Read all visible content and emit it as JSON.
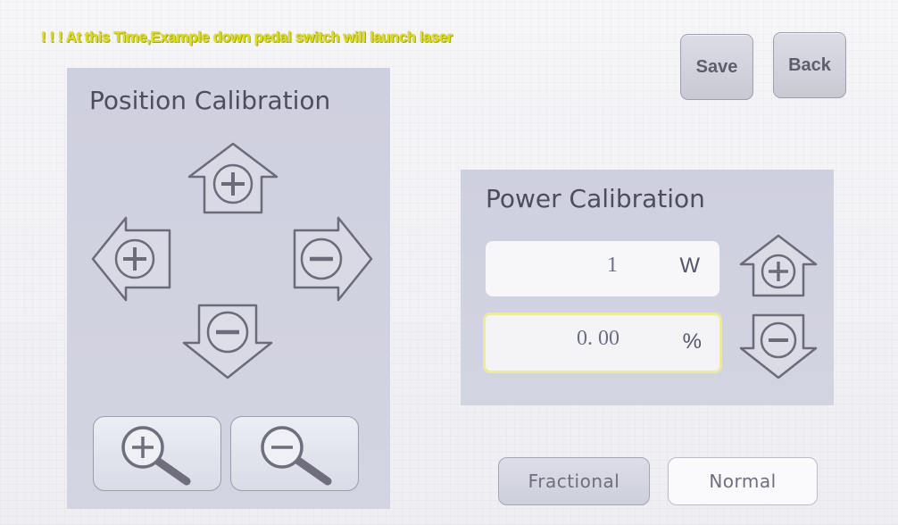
{
  "warning_text": "! ! ! At this Time,Example down pedal switch will launch laser",
  "header": {
    "save_label": "Save",
    "back_label": "Back"
  },
  "position_calibration": {
    "title": "Position Calibration",
    "controls": [
      "up-plus-arrow-icon",
      "left-plus-arrow-icon",
      "right-minus-arrow-icon",
      "down-minus-arrow-icon"
    ],
    "zoom": [
      "zoom-in-icon",
      "zoom-out-icon"
    ]
  },
  "power_calibration": {
    "title": "Power Calibration",
    "power_value": "1",
    "power_unit": "W",
    "percent_value": "0. 00",
    "percent_unit": "%"
  },
  "modes": {
    "fractional_label": "Fractional",
    "normal_label": "Normal"
  },
  "colors": {
    "panel": "#d1d2e0",
    "warning": "#dede1c",
    "active_border": "#ecea9c",
    "icon_stroke": "#6b6b7a"
  }
}
